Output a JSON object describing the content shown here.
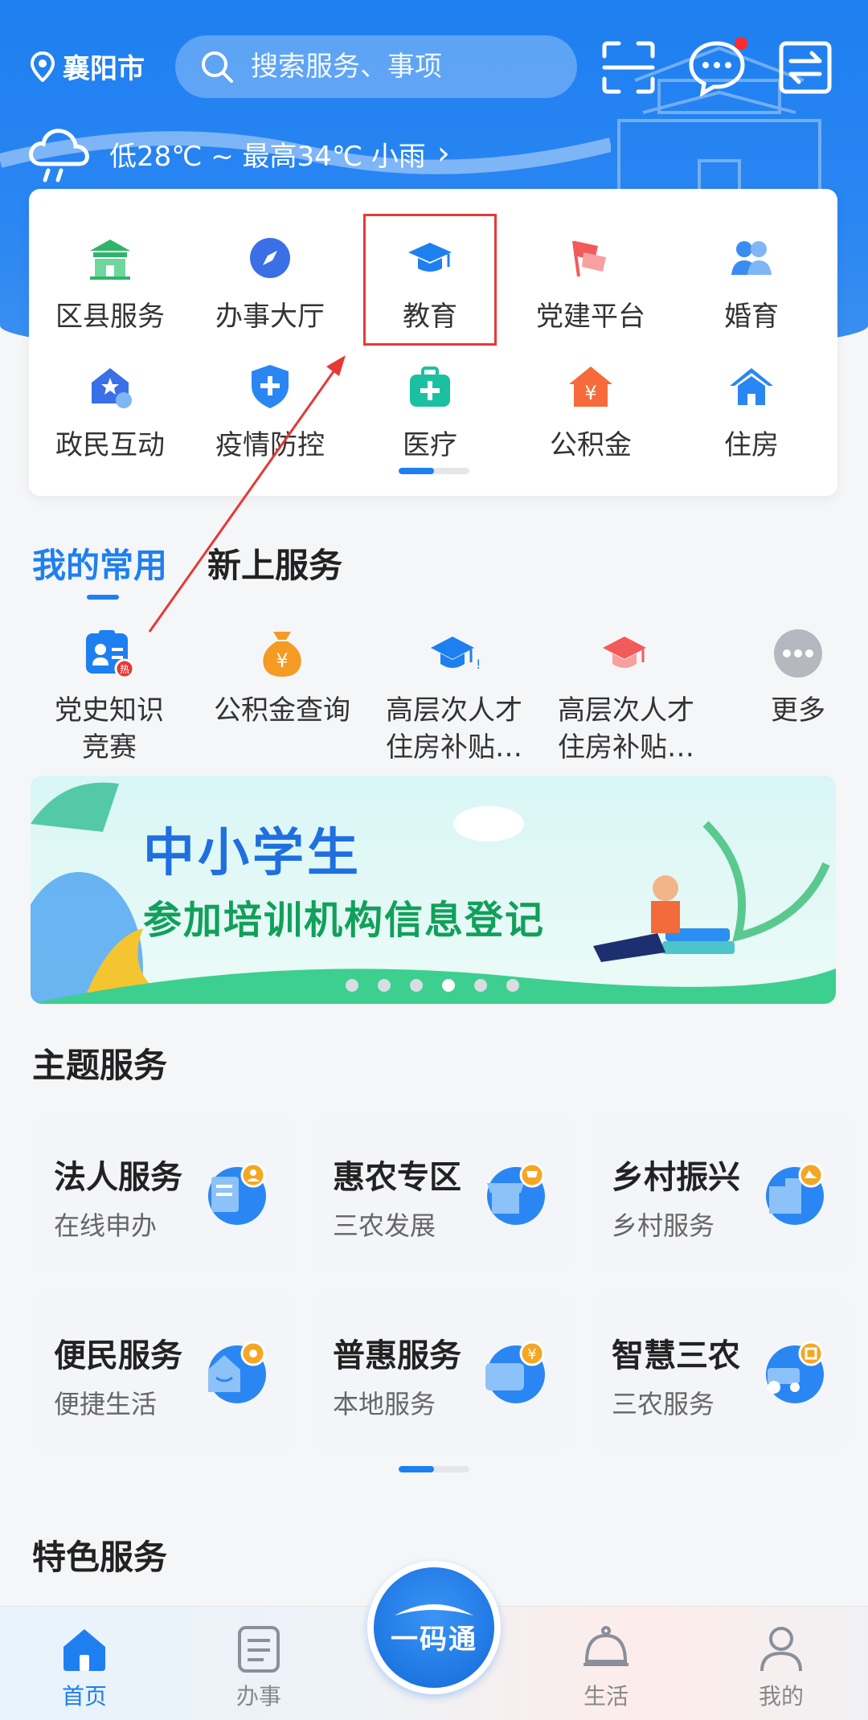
{
  "header": {
    "city": "襄阳市",
    "search_placeholder": "搜索服务、事项",
    "weather_text": "低28℃ ~ 最高34℃ 小雨"
  },
  "grid": {
    "items": [
      {
        "label": "区县服务",
        "icon": "building-icon",
        "color": "#2fb56a"
      },
      {
        "label": "办事大厅",
        "icon": "compass-icon",
        "color": "#3a6fe6"
      },
      {
        "label": "教育",
        "icon": "graduation-cap-icon",
        "color": "#1e7ff0"
      },
      {
        "label": "党建平台",
        "icon": "party-flag-icon",
        "color": "#f25b5b"
      },
      {
        "label": "婚育",
        "icon": "couple-icon",
        "color": "#3b8cf0"
      },
      {
        "label": "政民互动",
        "icon": "chat-star-icon",
        "color": "#3a6fe6"
      },
      {
        "label": "疫情防控",
        "icon": "shield-plus-icon",
        "color": "#2a86f2"
      },
      {
        "label": "医疗",
        "icon": "medical-kit-icon",
        "color": "#1bc0a0"
      },
      {
        "label": "公积金",
        "icon": "yuan-house-icon",
        "color": "#f66a3b"
      },
      {
        "label": "住房",
        "icon": "house-icon",
        "color": "#2a86f2"
      }
    ]
  },
  "tabs": [
    {
      "label": "我的常用"
    },
    {
      "label": "新上服务"
    }
  ],
  "frequent": [
    {
      "line1": "党史知识",
      "line2": "竞赛",
      "icon": "id-card-hot-icon"
    },
    {
      "line1": "公积金查询",
      "line2": "",
      "icon": "money-bag-icon"
    },
    {
      "line1": "高层次人才",
      "line2": "住房补贴…",
      "icon": "cap-blue-icon"
    },
    {
      "line1": "高层次人才",
      "line2": "住房补贴…",
      "icon": "cap-red-icon"
    },
    {
      "line1": "更多",
      "line2": "",
      "icon": "more-dots-icon"
    }
  ],
  "banner": {
    "title": "中小学生",
    "subtitle": "参加培训机构信息登记",
    "active_dot": 3
  },
  "theme": {
    "title": "主题服务",
    "cards": [
      {
        "title": "法人服务",
        "sub": "在线申办",
        "icon": "document-person-icon"
      },
      {
        "title": "惠农专区",
        "sub": "三农发展",
        "icon": "shop-cart-icon"
      },
      {
        "title": "乡村振兴",
        "sub": "乡村服务",
        "icon": "village-building-icon"
      },
      {
        "title": "便民服务",
        "sub": "便捷生活",
        "icon": "smile-house-icon"
      },
      {
        "title": "普惠服务",
        "sub": "本地服务",
        "icon": "wallet-yuan-icon"
      },
      {
        "title": "智慧三农",
        "sub": "三农服务",
        "icon": "tractor-icon"
      }
    ]
  },
  "special": {
    "title": "特色服务"
  },
  "nav": {
    "home": "首页",
    "affairs": "办事",
    "center": "一码通",
    "life": "生活",
    "mine": "我的"
  }
}
